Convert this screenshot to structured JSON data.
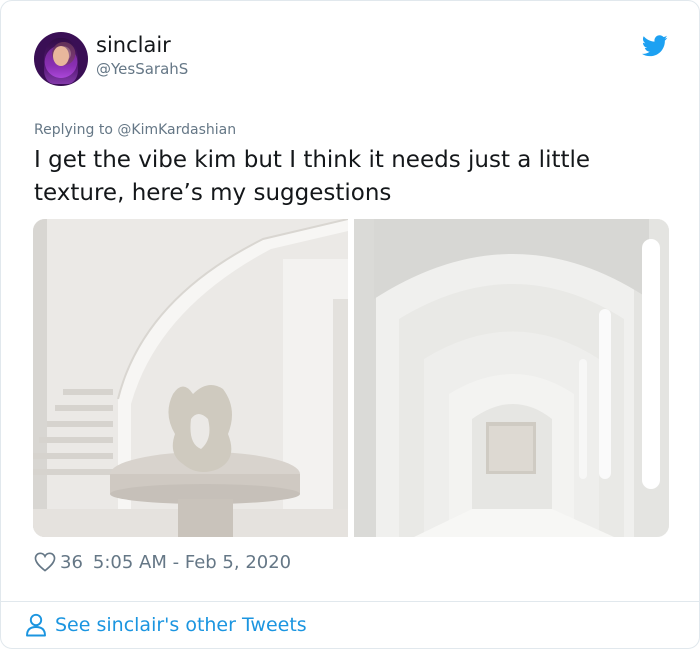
{
  "user": {
    "display_name": "sinclair",
    "handle": "@YesSarahS"
  },
  "reply": {
    "prefix": "Replying to ",
    "mention": "@KimKardashian"
  },
  "tweet": {
    "text": "I get the vibe kim but I think it needs just a little texture, here’s my suggestions"
  },
  "meta": {
    "like_count": "36",
    "timestamp": "5:05 AM - Feb 5, 2020"
  },
  "footer": {
    "see_more_label": "See sinclair's other Tweets"
  },
  "icons": {
    "heart": "heart-icon",
    "twitter": "twitter-bird-icon",
    "person": "person-icon"
  },
  "colors": {
    "twitter_blue": "#1da1f2",
    "link_blue": "#1b95e0",
    "secondary_text": "#657786",
    "primary_text": "#14171a",
    "border": "#e1e8ed"
  }
}
